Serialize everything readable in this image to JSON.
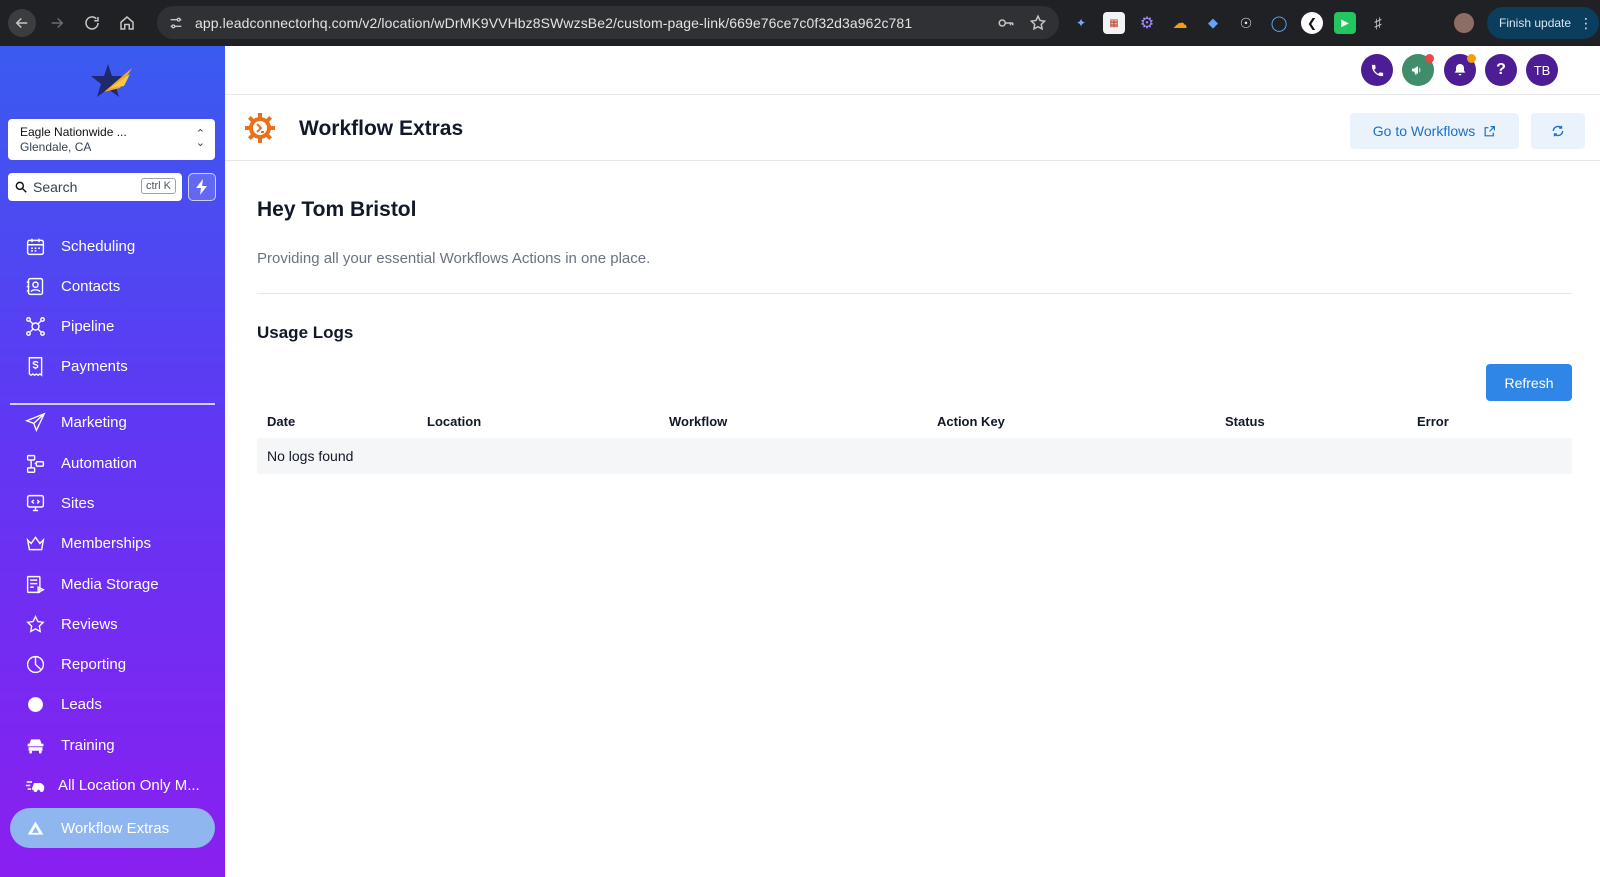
{
  "browser": {
    "url": "app.leadconnectorhq.com/v2/location/wDrMK9VVHbz8SWwzsBe2/custom-page-link/669e76ce7c0f32d3a962c781",
    "finish_update": "Finish update"
  },
  "sidebar": {
    "location_name": "Eagle Nationwide ...",
    "location_city": "Glendale, CA",
    "search_label": "Search",
    "search_shortcut": "ctrl K",
    "items": [
      {
        "label": "Scheduling",
        "icon": "calendar-icon"
      },
      {
        "label": "Contacts",
        "icon": "contact-card-icon"
      },
      {
        "label": "Pipeline",
        "icon": "pipeline-icon"
      },
      {
        "label": "Payments",
        "icon": "receipt-dollar-icon"
      },
      {
        "label": "Marketing",
        "icon": "paper-plane-icon"
      },
      {
        "label": "Automation",
        "icon": "workflow-icon"
      },
      {
        "label": "Sites",
        "icon": "monitor-code-icon"
      },
      {
        "label": "Memberships",
        "icon": "crown-icon"
      },
      {
        "label": "Media Storage",
        "icon": "media-storage-icon"
      },
      {
        "label": "Reviews",
        "icon": "star-outline-icon"
      },
      {
        "label": "Reporting",
        "icon": "pie-chart-icon"
      },
      {
        "label": "Leads",
        "icon": "circle-icon"
      },
      {
        "label": "Training",
        "icon": "car-icon"
      },
      {
        "label": "All Location Only M...",
        "icon": "fast-car-icon"
      },
      {
        "label": "Workflow Extras",
        "icon": "triangle-logo-icon",
        "active": true
      }
    ]
  },
  "header": {
    "avatar_initials": "TB"
  },
  "page": {
    "title": "Workflow Extras",
    "go_to_workflows": "Go to Workflows",
    "greeting": "Hey Tom Bristol",
    "subtitle": "Providing all your essential Workflows Actions in one place.",
    "usage_logs_title": "Usage Logs",
    "refresh_label": "Refresh",
    "table": {
      "columns": [
        "Date",
        "Location",
        "Workflow",
        "Action Key",
        "Status",
        "Error"
      ],
      "empty_message": "No logs found"
    }
  },
  "colors": {
    "sidebar_top": "#3a5bf0",
    "sidebar_bottom": "#8a1ff0",
    "primary_button": "#2f86e6",
    "header_icon": "#4c1d95"
  }
}
